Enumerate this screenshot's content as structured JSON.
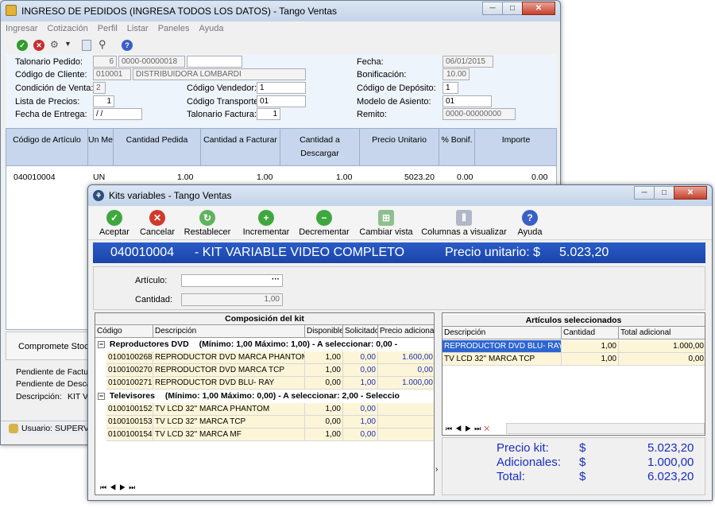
{
  "main": {
    "title": "INGRESO DE PEDIDOS (INGRESA TODOS LOS DATOS) - Tango Ventas",
    "menu": [
      "Ingresar",
      "Cotización",
      "Perfil",
      "Listar",
      "Paneles",
      "Ayuda"
    ],
    "form": {
      "talonario_label": "Talonario Pedido:",
      "talonario_num": "6",
      "talonario_nro": "0000-00000018",
      "talonario_extra": "",
      "cliente_label": "Código de Cliente:",
      "cliente_code": "010001",
      "cliente_name": "DISTRIBUIDORA LOMBARDI",
      "condicion_label": "Condición de Venta:",
      "condicion_value": "2",
      "lista_label": "Lista de Precios:",
      "lista_value": "1",
      "entrega_label": "Fecha de Entrega:",
      "entrega_value": "/ /",
      "vendedor_label": "Código Vendedor:",
      "vendedor_value": "1",
      "transporte_label": "Código Transporte:",
      "transporte_value": "01",
      "talfact_label": "Talonario Factura:",
      "talfact_value": "1",
      "fecha_label": "Fecha:",
      "fecha_value": "06/01/2015",
      "bonif_label": "Bonificación:",
      "bonif_value": "10.00",
      "deposito_label": "Código de Depósito:",
      "deposito_value": "1",
      "asiento_label": "Modelo de Asiento:",
      "asiento_value": "01",
      "remito_label": "Remito:",
      "remito_value": "0000-00000000"
    },
    "columns": [
      "Código de Artículo",
      "Un Me",
      "Cantidad Pedida",
      "Cantidad a Facturar",
      "Cantidad a Descargar",
      "Precio Unitario",
      "% Bonif.",
      "Importe"
    ],
    "row": [
      "040010004",
      "UN",
      "1.00",
      "1.00",
      "1.00",
      "5023.20",
      "0.00",
      "0.00"
    ],
    "bottom": {
      "stock_label": "Compromete Stock",
      "pend_fact": "Pendiente de Factura",
      "pend_desc": "Pendiente de Descarga",
      "descripcion": "Descripción:",
      "descripcion_value": "KIT VA",
      "status": "Usuario: SUPERVIS"
    }
  },
  "kit": {
    "title": "Kits variables - Tango Ventas",
    "toolbar": {
      "accept": "Aceptar",
      "cancel": "Cancelar",
      "reset": "Restablecer",
      "increment": "Incrementar",
      "decrement": "Decrementar",
      "change_view": "Cambiar vista",
      "columns": "Columnas a visualizar",
      "help": "Ayuda"
    },
    "header": {
      "code": "040010004",
      "name": "- KIT VARIABLE VIDEO COMPLETO",
      "price_label": "Precio unitario: $",
      "price": "5.023,20"
    },
    "articulo_label": "Artículo:",
    "articulo_value": "",
    "cantidad_label": "Cantidad:",
    "cantidad_value": "1,00",
    "composicion": {
      "title": "Composición del kit",
      "columns": [
        "Código",
        "Descripción",
        "Disponible",
        "Solicitado",
        "Precio adicional"
      ],
      "groups": [
        {
          "label": "Reproductores DVD",
          "detail": "(Mínimo: 1,00 Máximo: 1,00)  -   A seleccionar: 0,00  -",
          "rows": [
            [
              "0100100268",
              "REPRODUCTOR DVD MARCA PHANTOM",
              "1,00",
              "0,00",
              "1.600,00"
            ],
            [
              "0100100270",
              "REPRODUCTOR DVD MARCA TCP",
              "1,00",
              "0,00",
              "0,00"
            ],
            [
              "0100100271",
              "REPRODUCTOR DVD BLU- RAY",
              "0,00",
              "1,00",
              "1.000,00"
            ]
          ]
        },
        {
          "label": "Televisores",
          "detail": "(Mínimo: 1,00 Máximo: 0,00)  -   A seleccionar: 2,00  -   Seleccio",
          "rows": [
            [
              "0100100152",
              "TV LCD 32'' MARCA PHANTOM",
              "1,00",
              "0,00",
              ""
            ],
            [
              "0100100153",
              "TV LCD 32'' MARCA TCP",
              "0,00",
              "1,00",
              ""
            ],
            [
              "0100100154",
              "TV LCD 32'' MARCA MF",
              "1,00",
              "0,00",
              ""
            ]
          ]
        }
      ]
    },
    "seleccionados": {
      "title": "Artículos seleccionados",
      "columns": [
        "Descripción",
        "Cantidad",
        "Total adicional"
      ],
      "rows": [
        [
          "REPRODUCTOR DVD BLU- RAY",
          "1,00",
          "1.000,00"
        ],
        [
          "TV LCD 32'' MARCA TCP",
          "1,00",
          "0,00"
        ]
      ]
    },
    "totals": {
      "precio_label": "Precio kit:",
      "precio_cur": "$",
      "precio": "5.023,20",
      "adic_label": "Adicionales:",
      "adic_cur": "$",
      "adic": "1.000,00",
      "total_label": "Total:",
      "total_cur": "$",
      "total": "6.023,20"
    },
    "colors": {
      "header": "#1b44a8",
      "totals_text": "#1a2ec0",
      "row_bg": "#fcf5d8",
      "selected_bg": "#2e66d0"
    }
  }
}
